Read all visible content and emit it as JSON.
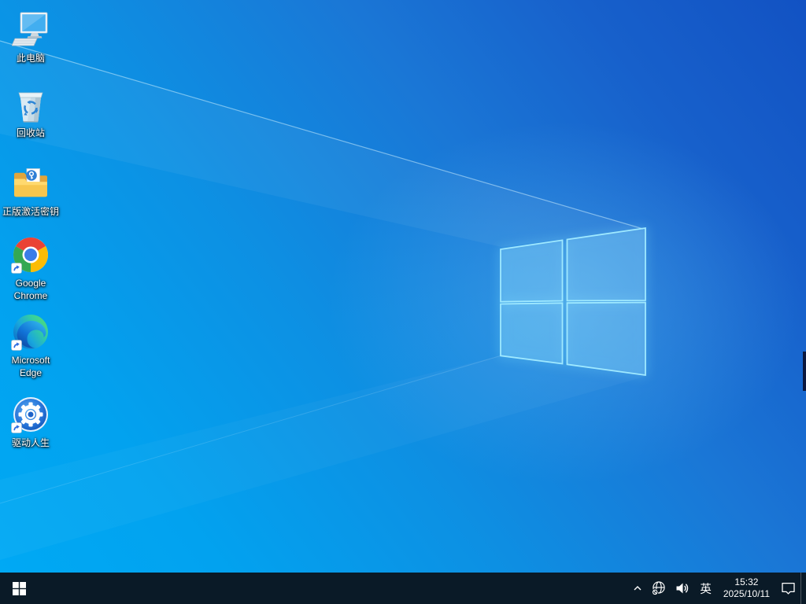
{
  "theme": {
    "wallpaper_bright": "#00a9f4",
    "wallpaper_dark": "#1252c3",
    "logo_border": "#9fe9ff",
    "logo_fill": "rgba(165,228,255,0.26)",
    "taskbar_bg": "#0a1a27",
    "icon_label_color": "#ffffff"
  },
  "desktop": {
    "icons": [
      {
        "label": "此电脑",
        "icon": "this-pc-icon",
        "shortcut": false
      },
      {
        "label": "回收站",
        "icon": "recycle-bin-icon",
        "shortcut": false
      },
      {
        "label": "正版激活密钥",
        "icon": "folder-key-icon",
        "shortcut": false
      },
      {
        "label": "Google Chrome",
        "icon": "chrome-icon",
        "shortcut": true
      },
      {
        "label": "Microsoft Edge",
        "icon": "edge-icon",
        "shortcut": true
      },
      {
        "label": "驱动人生",
        "icon": "driver-gear-icon",
        "shortcut": true
      }
    ]
  },
  "taskbar": {
    "start": {
      "icon": "windows-logo-icon"
    },
    "tray": {
      "hidden_icons_chevron": "^",
      "network_icon": "globe-no-internet-icon",
      "volume_icon": "speaker-icon",
      "language_indicator": "英",
      "clock": {
        "time": "15:32",
        "date": "2025/10/11"
      },
      "action_center_icon": "notification-bubble-icon"
    }
  }
}
